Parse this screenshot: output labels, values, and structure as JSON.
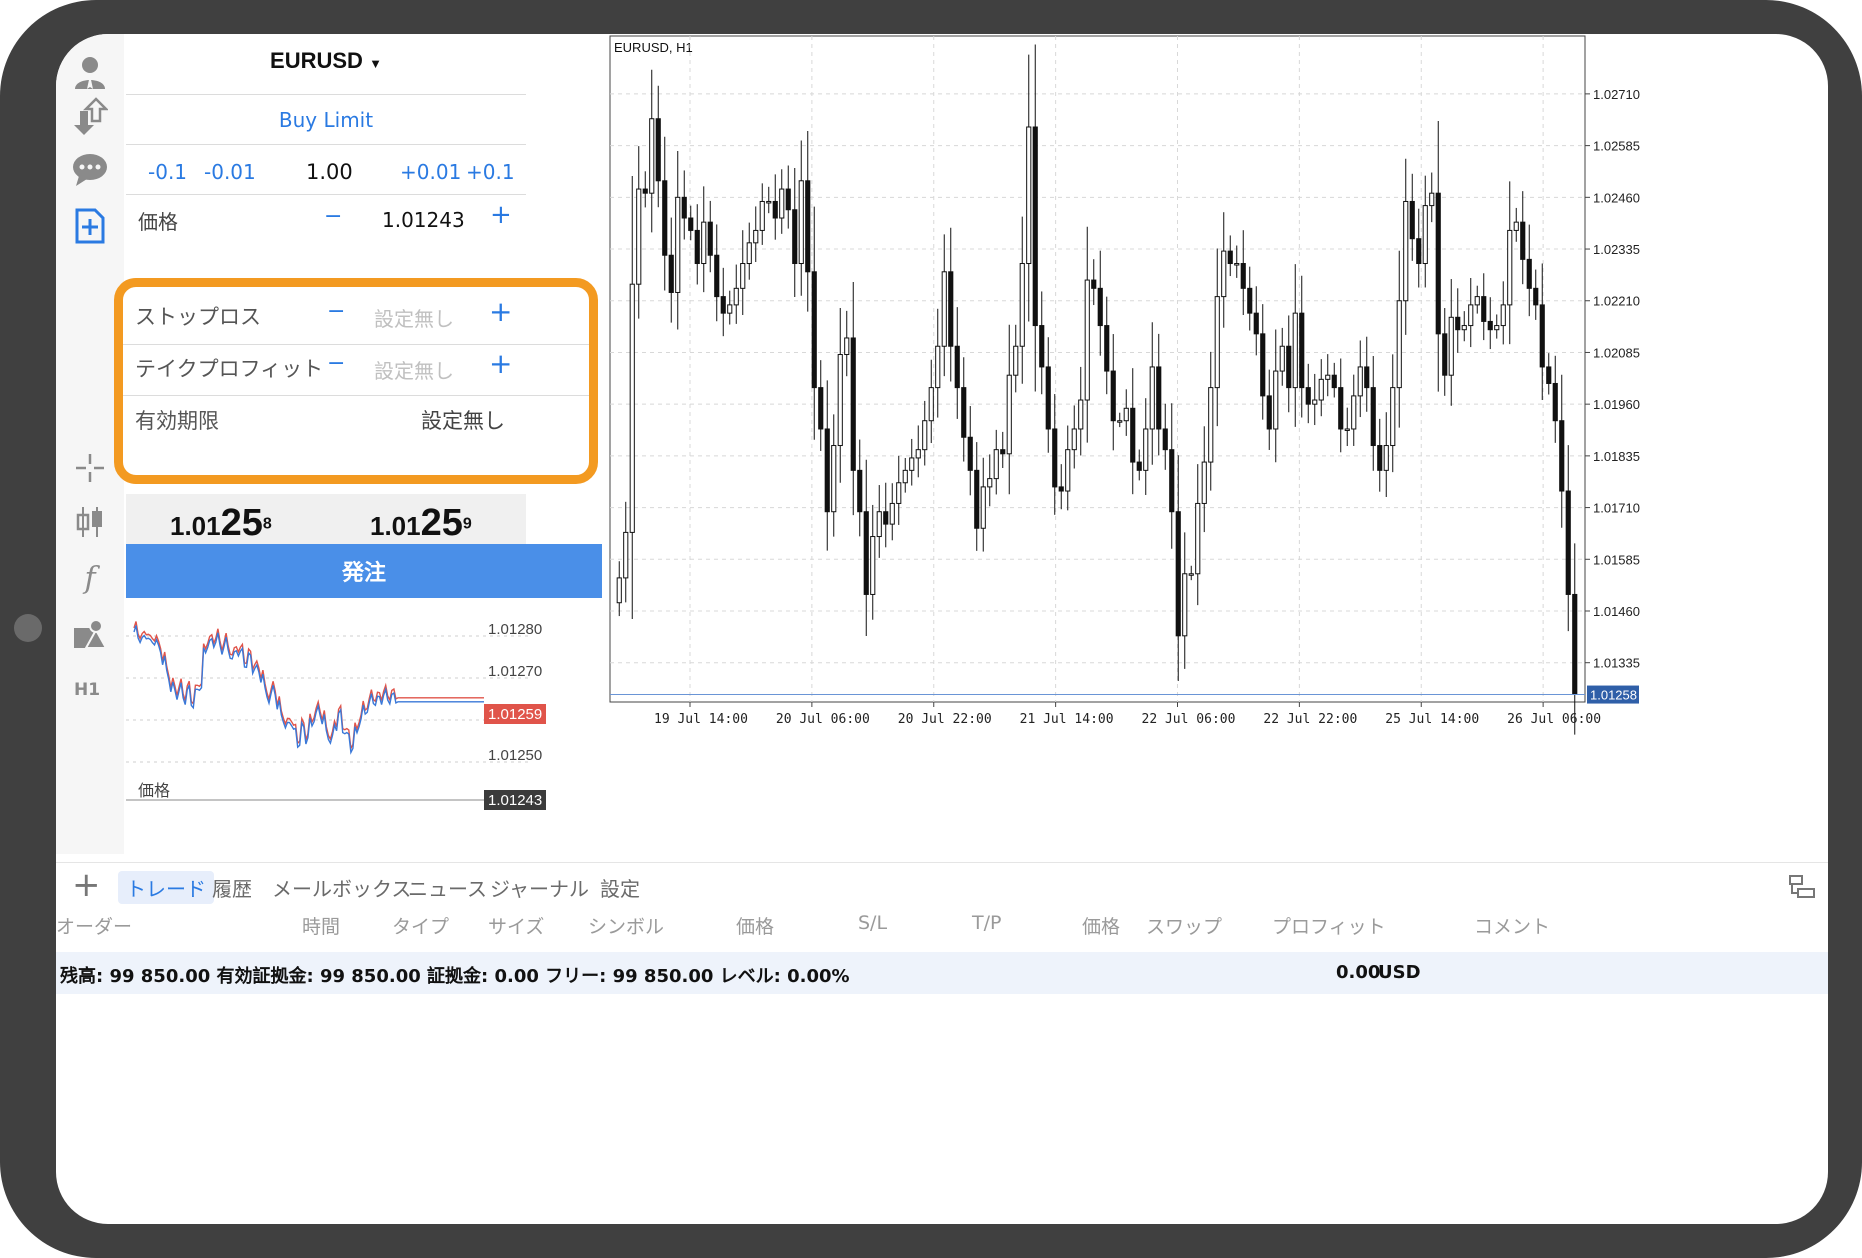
{
  "symbol": {
    "name": "EURUSD",
    "caret": "▼"
  },
  "order_type": "Buy Limit",
  "volume": {
    "minus_big": "-0.1",
    "minus_small": "-0.01",
    "value": "1.00",
    "plus_small": "+0.01",
    "plus_big": "+0.1"
  },
  "price_row": {
    "label": "価格",
    "minus": "−",
    "value": "1.01243",
    "plus": "+"
  },
  "stop_loss": {
    "label": "ストップロス",
    "minus": "−",
    "value": "設定無し",
    "plus": "+"
  },
  "take_profit": {
    "label": "テイクプロフィット",
    "minus": "−",
    "value": "設定無し",
    "plus": "+"
  },
  "expiry": {
    "label": "有効期限",
    "value": "設定無し"
  },
  "quotes": {
    "bid_prefix": "1.01",
    "bid_big": "25",
    "bid_sup": "8",
    "ask_prefix": "1.01",
    "ask_big": "25",
    "ask_sup": "9"
  },
  "order_button": "発注",
  "sidebar_icons": [
    "account-icon",
    "transfer-icon",
    "chat-icon",
    "new-order-icon",
    "crosshair-icon",
    "candle-icon",
    "function-icon",
    "objects-icon"
  ],
  "timeframe_label": "H1",
  "tick_chart": {
    "price_labels": [
      "1.01280",
      "1.01270",
      "1.01250"
    ],
    "ask_tag": "1.01259",
    "bid_tag": "1.01243",
    "x_label": "価格",
    "colors": {
      "ask": "#e0544a",
      "bid": "#3a78d8"
    }
  },
  "chart_data": {
    "type": "candlestick",
    "title": "EURUSD, H1",
    "y_ticks": [
      "1.02710",
      "1.02585",
      "1.02460",
      "1.02335",
      "1.02210",
      "1.02085",
      "1.01960",
      "1.01835",
      "1.01710",
      "1.01585",
      "1.01460",
      "1.01335"
    ],
    "x_ticks": [
      "19 Jul 14:00",
      "20 Jul 06:00",
      "20 Jul 22:00",
      "21 Jul 14:00",
      "22 Jul 06:00",
      "22 Jul 22:00",
      "25 Jul 14:00",
      "26 Jul 06:00"
    ],
    "ylim": [
      1.0124,
      1.0285
    ],
    "current_price": "1.01258",
    "grid": true,
    "close_series": [
      1.0154,
      1.0165,
      1.0225,
      1.0248,
      1.0247,
      1.0265,
      1.025,
      1.0232,
      1.0223,
      1.0246,
      1.0241,
      1.0238,
      1.023,
      1.024,
      1.0232,
      1.0222,
      1.0218,
      1.022,
      1.0224,
      1.023,
      1.0235,
      1.0238,
      1.0245,
      1.0245,
      1.0241,
      1.0248,
      1.0243,
      1.023,
      1.025,
      1.0228,
      1.02,
      1.019,
      1.017,
      1.0186,
      1.0208,
      1.0212,
      1.018,
      1.017,
      1.015,
      1.0164,
      1.017,
      1.0167,
      1.0172,
      1.0177,
      1.018,
      1.0183,
      1.0185,
      1.0192,
      1.02,
      1.021,
      1.0228,
      1.021,
      1.02,
      1.0188,
      1.018,
      1.0166,
      1.0176,
      1.0178,
      1.0185,
      1.0184,
      1.0203,
      1.021,
      1.023,
      1.0263,
      1.0215,
      1.0205,
      1.019,
      1.0176,
      1.0175,
      1.0185,
      1.019,
      1.0197,
      1.0226,
      1.0224,
      1.0215,
      1.0204,
      1.0192,
      1.0192,
      1.0195,
      1.0182,
      1.018,
      1.019,
      1.0205,
      1.019,
      1.0185,
      1.017,
      1.014,
      1.0155,
      1.0155,
      1.0172,
      1.0182,
      1.02,
      1.0222,
      1.0233,
      1.023,
      1.023,
      1.0224,
      1.0218,
      1.0213,
      1.0198,
      1.019,
      1.0204,
      1.021,
      1.02,
      1.0218,
      1.02,
      1.0196,
      1.0197,
      1.0202,
      1.0203,
      1.02,
      1.019,
      1.019,
      1.0198,
      1.0205,
      1.02,
      1.0186,
      1.018,
      1.0186,
      1.02,
      1.0221,
      1.0245,
      1.0236,
      1.023,
      1.0244,
      1.0247,
      1.0213,
      1.0203,
      1.0217,
      1.0214,
      1.0215,
      1.022,
      1.0222,
      1.0216,
      1.0214,
      1.0215,
      1.022,
      1.0238,
      1.024,
      1.0231,
      1.0224,
      1.022,
      1.0205,
      1.0201,
      1.0192,
      1.0175,
      1.015,
      1.0126
    ]
  },
  "bottom_tabs": {
    "add": "+",
    "items": [
      "トレード",
      "履歴",
      "メールボックス",
      "ニュース",
      "ジャーナル",
      "設定"
    ]
  },
  "columns": [
    "オーダー",
    "時間",
    "タイプ",
    "サイズ",
    "シンボル",
    "価格",
    "S/L",
    "T/P",
    "価格",
    "スワップ",
    "プロフィット",
    "コメント"
  ],
  "balance": {
    "text": "残高: 99 850.00 有効証拠金: 99 850.00 証拠金: 0.00 フリー: 99 850.00 レベル: 0.00%",
    "profit": "0.00",
    "currency": "USD"
  }
}
